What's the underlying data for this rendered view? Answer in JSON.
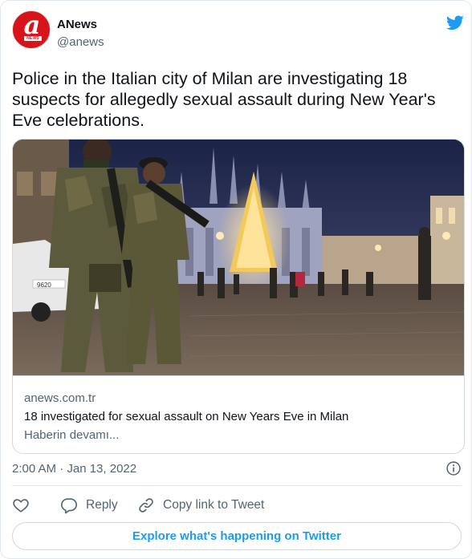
{
  "account": {
    "name": "ANews",
    "handle": "@anews",
    "avatar_letter": "a",
    "avatar_word": "NEWS"
  },
  "tweet": {
    "text": "Police in the Italian city of Milan are investigating 18 suspects for allegedly sexual assault during New Year's Eve celebrations."
  },
  "link_card": {
    "domain": "anews.com.tr",
    "title": "18 investigated for sexual assault on New Years Eve in Milan",
    "description": "Haberin devamı...",
    "photo_car_number": "9620"
  },
  "timestamp": "2:00 AM · Jan 13, 2022",
  "actions": {
    "like": "",
    "reply": "Reply",
    "copy_link": "Copy link to Tweet"
  },
  "explore_button": "Explore what's happening on Twitter",
  "colors": {
    "brand_red": "#d7141a",
    "twitter_blue": "#1d9bf0",
    "secondary_text": "#536471",
    "primary_text": "#0f1419",
    "border": "#cfd9de"
  },
  "icons": [
    "twitter-bird-icon",
    "info-icon",
    "heart-icon",
    "reply-icon",
    "link-icon"
  ]
}
